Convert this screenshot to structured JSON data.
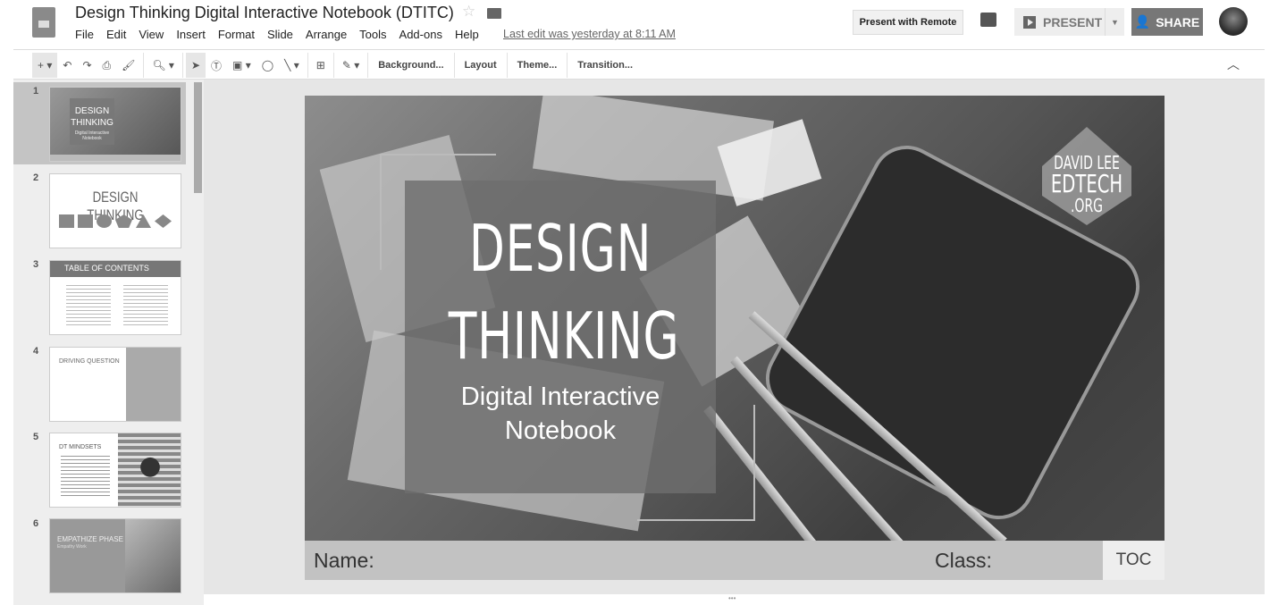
{
  "header": {
    "title": "Design Thinking Digital Interactive Notebook (DTITC)",
    "menu": [
      "File",
      "Edit",
      "View",
      "Insert",
      "Format",
      "Slide",
      "Arrange",
      "Tools",
      "Add-ons",
      "Help"
    ],
    "last_edit": "Last edit was yesterday at 8:11 AM",
    "present_remote": "Present with Remote",
    "present": "PRESENT",
    "share": "SHARE"
  },
  "toolbar": {
    "background": "Background...",
    "layout": "Layout",
    "theme": "Theme...",
    "transition": "Transition..."
  },
  "filmstrip": {
    "selected": 1,
    "slides": [
      {
        "num": "1",
        "title": "DESIGN THINKING",
        "sub": "Digital Interactive Notebook"
      },
      {
        "num": "2",
        "title": "DESIGN THINKING"
      },
      {
        "num": "3",
        "title": "TABLE OF CONTENTS"
      },
      {
        "num": "4",
        "title": "DRIVING QUESTION"
      },
      {
        "num": "5",
        "title": "DT MINDSETS"
      },
      {
        "num": "6",
        "title": "EMPATHIZE PHASE",
        "sub": "Empathy Work"
      }
    ]
  },
  "slide": {
    "title_line1": "DESIGN",
    "title_line2": "THINKING",
    "subtitle_line1": "Digital Interactive",
    "subtitle_line2": "Notebook",
    "logo": [
      "DAVID LEE",
      "EDTECH",
      ".ORG"
    ],
    "name_label": "Name:",
    "class_label": "Class:",
    "toc": "TOC"
  }
}
